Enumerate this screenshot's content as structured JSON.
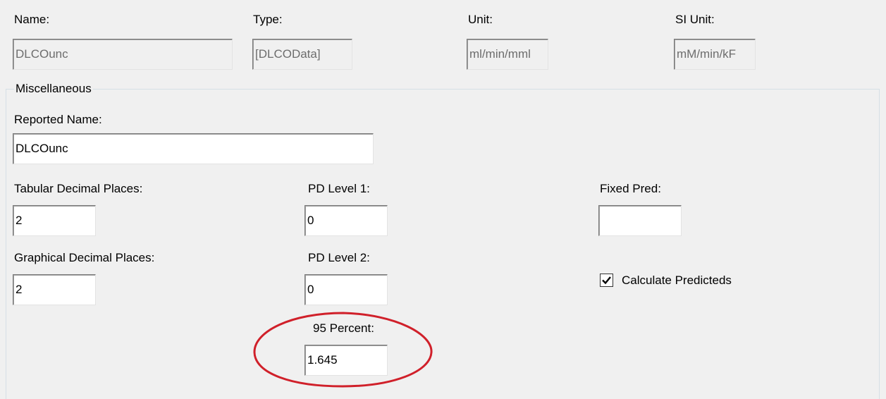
{
  "header": {
    "name": {
      "label": "Name:",
      "value": "DLCOunc"
    },
    "type": {
      "label": "Type:",
      "value": "[DLCOData]"
    },
    "unit": {
      "label": "Unit:",
      "value": "ml/min/mml"
    },
    "si_unit": {
      "label": "SI Unit:",
      "value": "mM/min/kF"
    }
  },
  "misc": {
    "legend": "Miscellaneous",
    "reported_name": {
      "label": "Reported Name:",
      "value": "DLCOunc"
    },
    "tabular_decimal": {
      "label": "Tabular Decimal Places:",
      "value": "2"
    },
    "graphical_decimal": {
      "label": "Graphical Decimal Places:",
      "value": "2"
    },
    "pd_level_1": {
      "label": "PD Level 1:",
      "value": "0"
    },
    "pd_level_2": {
      "label": "PD Level 2:",
      "value": "0"
    },
    "percent_95": {
      "label": "95 Percent:",
      "value": "1.645"
    },
    "fixed_pred": {
      "label": "Fixed Pred:",
      "value": ""
    },
    "calculate_predicteds": {
      "label": "Calculate Predicteds",
      "checked": true
    }
  },
  "annotation_color": "#d0202a"
}
